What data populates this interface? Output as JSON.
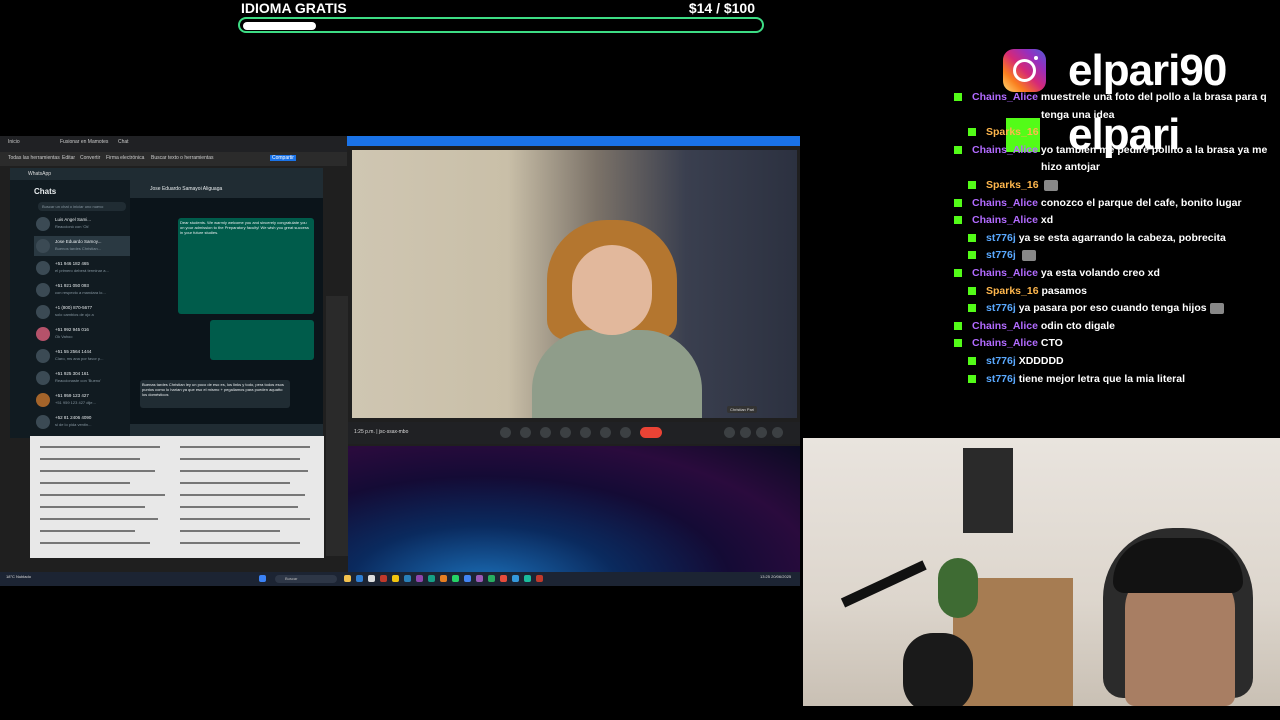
{
  "goal": {
    "label": "IDIOMA GRATIS",
    "current": "$14",
    "target": "/ $100",
    "progress": 0.14
  },
  "desktop": {
    "browser_tabs": [
      "Inicio",
      "Fusionar en Mamotes",
      "Chat"
    ],
    "browser_toolbar": [
      "Todas las herramientas",
      "Editar",
      "Convertir",
      "Firma electrónica",
      "Buscar texto o herramientas",
      "Compartir"
    ],
    "whatsapp": {
      "app_name": "WhatsApp",
      "chats_title": "Chats",
      "search_placeholder": "Buscar un chat o iniciar uno nuevo",
      "contact_header": "Jose Eduardo Samayoi Aliguaga",
      "chats": [
        {
          "name": "Luis Angel Sami...",
          "preview": "Reaccionó con 'Ok'"
        },
        {
          "name": "Jose Eduardo Samoy...",
          "preview": "Buenos tardes Christian..."
        },
        {
          "name": "+51 946 182 465",
          "preview": "el primero deberá terminar a..."
        },
        {
          "name": "+51 921 050 093",
          "preview": "con respecto a mandara lo..."
        },
        {
          "name": "+1 (800) 870-5677",
          "preview": "solo cambios de ojo a"
        },
        {
          "name": "+51 992 945 016",
          "preview": "Ok Vahoo"
        },
        {
          "name": "+51 55 2564 1444",
          "preview": "Claro, ms ana por favor p..."
        },
        {
          "name": "+51 925 304 161",
          "preview": "Reaccionaste con 'Bueno'"
        },
        {
          "name": "+51 959 123 427",
          "preview": "+51 959 123 427 dije..."
        },
        {
          "name": "+52 81 2406 4090",
          "preview": "si de lo pida ventin..."
        }
      ],
      "bubble_text": "Dear students. We warmly welcome you and sincerely congratulate you on your admission to the Preparatory faculty! We wish you great success in your future studies.",
      "reply_text": "Buenas tardes Christian ley un poco de eso es, los links y todo, pera todos esos puntos como lo harían ya que eso el mismo + pegaliamos para pueden aquatto los domésticos"
    },
    "meet": {
      "time_code": "1:25 p.m.  |  jsc-ssax-mbo",
      "participant_name": "Christian Pari"
    },
    "taskbar": {
      "weather": "18°C Nublado",
      "search": "Buscar",
      "clock": "13:25\n20/06/2025"
    }
  },
  "overlay": {
    "instagram_handle": "elpari90",
    "kick_handle": "elpari"
  },
  "chat": {
    "messages": [
      {
        "user": "Chains_Alice",
        "text": "muestrele una foto del pollo a la brasa para q",
        "cont": "tenga una idea",
        "emote": false,
        "badge": false
      },
      {
        "user": "Sparks_16",
        "text": "",
        "emote": false,
        "badge": true
      },
      {
        "user": "Chains_Alice",
        "text": "yo tambien me pedire pollito a la brasa ya me",
        "cont": "hizo antojar",
        "emote": false,
        "badge": false
      },
      {
        "user": "Sparks_16",
        "text": "",
        "emote": true,
        "badge": true
      },
      {
        "user": "Chains_Alice",
        "text": "conozco el parque del cafe, bonito lugar",
        "emote": false,
        "badge": false
      },
      {
        "user": "Chains_Alice",
        "text": "xd",
        "emote": false,
        "badge": false
      },
      {
        "user": "st776j",
        "text": "ya se esta agarrando la cabeza, pobrecita",
        "emote": false,
        "badge": true
      },
      {
        "user": "st776j",
        "text": "",
        "emote": true,
        "badge": true
      },
      {
        "user": "Chains_Alice",
        "text": "ya esta volando creo xd",
        "emote": false,
        "badge": false
      },
      {
        "user": "Sparks_16",
        "text": "pasamos",
        "emote": false,
        "badge": true
      },
      {
        "user": "st776j",
        "text": "ya pasara por eso cuando tenga hijos",
        "emote": true,
        "badge": true
      },
      {
        "user": "Chains_Alice",
        "text": "odin cto digale",
        "emote": false,
        "badge": false
      },
      {
        "user": "Chains_Alice",
        "text": "CTO",
        "emote": false,
        "badge": false
      },
      {
        "user": "st776j",
        "text": "XDDDDD",
        "emote": false,
        "badge": true
      },
      {
        "user": "st776j",
        "text": "tiene mejor letra que la mia literal",
        "emote": false,
        "badge": true
      }
    ]
  }
}
